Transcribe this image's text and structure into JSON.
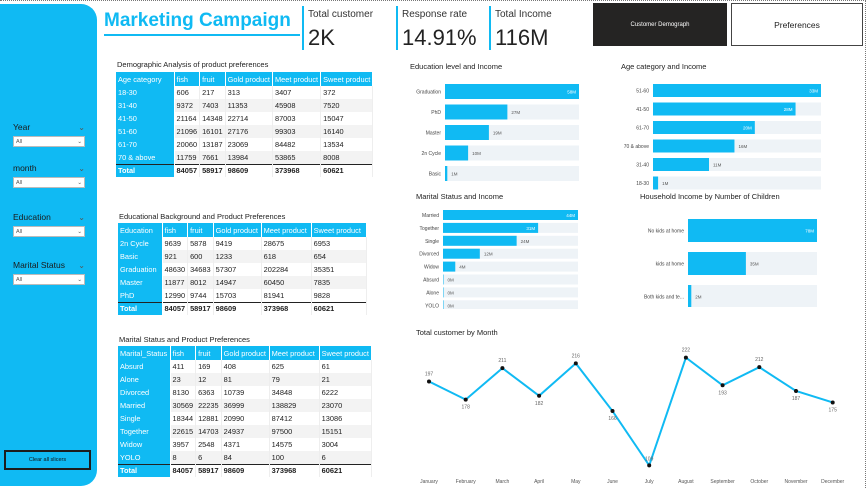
{
  "title": "Marketing Campaign",
  "kpis": [
    {
      "label": "Total customer",
      "value": "2K"
    },
    {
      "label": "Response rate",
      "value": "14.91%"
    },
    {
      "label": "Total Income",
      "value": "116M"
    }
  ],
  "nav": {
    "customer_demograph": "Customer Demograph",
    "preferences": "Preferences"
  },
  "sidebar": {
    "slicers": [
      {
        "label": "Year",
        "value": "All"
      },
      {
        "label": "month",
        "value": "All"
      },
      {
        "label": "Education",
        "value": "All"
      },
      {
        "label": "Marital Status",
        "value": "All"
      }
    ],
    "clear_label": "Clear all slicers"
  },
  "tables": [
    {
      "title": "Demographic Analysis of product preferences",
      "headers": [
        "Age category",
        "fish",
        "fruit",
        "Gold product",
        "Meet product",
        "Sweet product"
      ],
      "rows": [
        [
          "18-30",
          "606",
          "217",
          "313",
          "3407",
          "372"
        ],
        [
          "31-40",
          "9372",
          "7403",
          "11353",
          "45908",
          "7520"
        ],
        [
          "41-50",
          "21164",
          "14348",
          "22714",
          "87003",
          "15047"
        ],
        [
          "51-60",
          "21096",
          "16101",
          "27176",
          "99303",
          "16140"
        ],
        [
          "61-70",
          "20060",
          "13187",
          "23069",
          "84482",
          "13534"
        ],
        [
          "70 & above",
          "11759",
          "7661",
          "13984",
          "53865",
          "8008"
        ]
      ],
      "total": [
        "Total",
        "84057",
        "58917",
        "98609",
        "373968",
        "60621"
      ]
    },
    {
      "title": "Educational Background and Product Preferences",
      "headers": [
        "Education",
        "fish",
        "fruit",
        "Gold product",
        "Meet product",
        "Sweet product"
      ],
      "rows": [
        [
          "2n Cycle",
          "9639",
          "5878",
          "9419",
          "28675",
          "6953"
        ],
        [
          "Basic",
          "921",
          "600",
          "1233",
          "618",
          "654"
        ],
        [
          "Graduation",
          "48630",
          "34683",
          "57307",
          "202284",
          "35351"
        ],
        [
          "Master",
          "11877",
          "8012",
          "14947",
          "60450",
          "7835"
        ],
        [
          "PhD",
          "12990",
          "9744",
          "15703",
          "81941",
          "9828"
        ]
      ],
      "total": [
        "Total",
        "84057",
        "58917",
        "98609",
        "373968",
        "60621"
      ]
    },
    {
      "title": "Marital Status and Product Preferences",
      "headers": [
        "Marital_Status",
        "fish",
        "fruit",
        "Gold product",
        "Meet product",
        "Sweet product"
      ],
      "rows": [
        [
          "Absurd",
          "411",
          "169",
          "408",
          "625",
          "61"
        ],
        [
          "Alone",
          "23",
          "12",
          "81",
          "79",
          "21"
        ],
        [
          "Divorced",
          "8130",
          "6363",
          "10739",
          "34848",
          "6222"
        ],
        [
          "Married",
          "30569",
          "22235",
          "36999",
          "138829",
          "23070"
        ],
        [
          "Single",
          "18344",
          "12881",
          "20990",
          "87412",
          "13086"
        ],
        [
          "Together",
          "22615",
          "14703",
          "24937",
          "97500",
          "15151"
        ],
        [
          "Widow",
          "3957",
          "2548",
          "4371",
          "14575",
          "3004"
        ],
        [
          "YOLO",
          "8",
          "6",
          "84",
          "100",
          "6"
        ]
      ],
      "total": [
        "Total",
        "84057",
        "58917",
        "98609",
        "373968",
        "60621"
      ]
    }
  ],
  "chart_data": [
    {
      "type": "bar",
      "orientation": "horizontal",
      "title": "Education level and Income",
      "categories": [
        "Graduation",
        "PhD",
        "Master",
        "2n Cycle",
        "Basic"
      ],
      "values": [
        58,
        27,
        19,
        10,
        1
      ],
      "labels": [
        "58M",
        "27M",
        "19M",
        "10M",
        "1M"
      ]
    },
    {
      "type": "bar",
      "orientation": "horizontal",
      "title": "Age category and Income",
      "categories": [
        "51-60",
        "41-50",
        "61-70",
        "70 & above",
        "31-40",
        "18-30"
      ],
      "values": [
        33,
        28,
        20,
        16,
        11,
        1
      ],
      "labels": [
        "33M",
        "28M",
        "20M",
        "16M",
        "11M",
        "1M"
      ]
    },
    {
      "type": "bar",
      "orientation": "horizontal",
      "title": "Marital Status and Income",
      "categories": [
        "Married",
        "Together",
        "Single",
        "Divorced",
        "Widow",
        "Absurd",
        "Alone",
        "YOLO"
      ],
      "values": [
        44,
        31,
        24,
        12,
        4,
        0,
        0,
        0
      ],
      "labels": [
        "44M",
        "31M",
        "24M",
        "12M",
        "4M",
        "0M",
        "0M",
        "0M"
      ]
    },
    {
      "type": "bar",
      "orientation": "horizontal",
      "title": "Household Income by Number of Children",
      "categories": [
        "No kids at home",
        "kids at home",
        "Both kids and te..."
      ],
      "values": [
        78,
        35,
        2
      ],
      "labels": [
        "78M",
        "35M",
        "2M"
      ]
    },
    {
      "type": "line",
      "title": "Total customer by Month",
      "categories": [
        "January",
        "February",
        "March",
        "April",
        "May",
        "June",
        "July",
        "August",
        "September",
        "October",
        "November",
        "December"
      ],
      "values": [
        197,
        178,
        211,
        182,
        216,
        166,
        109,
        222,
        193,
        212,
        187,
        175
      ],
      "ylim": [
        100,
        230
      ]
    }
  ],
  "colors": {
    "accent": "#10baf3",
    "bar_light": "#eef3f7",
    "dark_button": "#252423"
  }
}
